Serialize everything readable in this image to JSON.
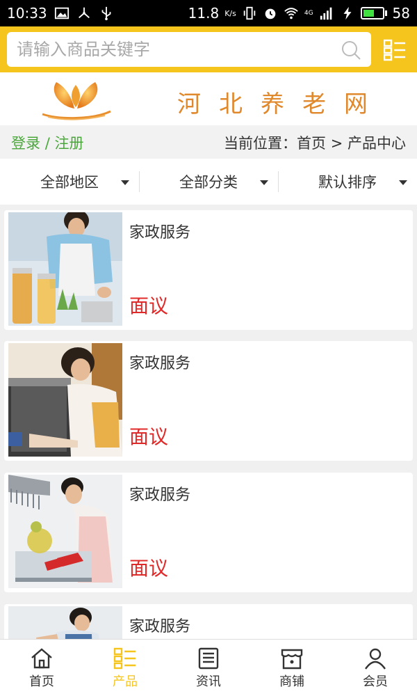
{
  "status_bar": {
    "time": "10:33",
    "speed": "11.8",
    "speed_unit": "K/s",
    "network": "4G",
    "battery": "58",
    "battery_level": 0.58,
    "icons": [
      "image-icon",
      "share-icon",
      "usb-icon",
      "vibrate-icon",
      "alarm-icon",
      "wifi-icon",
      "signal-icon",
      "charging-icon",
      "battery-icon"
    ]
  },
  "search": {
    "placeholder": "请输入商品关键字"
  },
  "brand": {
    "title": "河北养老网"
  },
  "breadcrumb": {
    "login": "登录",
    "separator": "/",
    "register": "注册",
    "location": "当前位置：首页 > 产品中心"
  },
  "filters": [
    {
      "label": "全部地区"
    },
    {
      "label": "全部分类"
    },
    {
      "label": "默认排序"
    }
  ],
  "products": [
    {
      "name": "家政服务",
      "price": "面议"
    },
    {
      "name": "家政服务",
      "price": "面议"
    },
    {
      "name": "家政服务",
      "price": "面议"
    },
    {
      "name": "家政服务",
      "price": ""
    }
  ],
  "nav": {
    "items": [
      {
        "label": "首页",
        "icon": "home-icon",
        "active": false
      },
      {
        "label": "产品",
        "icon": "product-icon",
        "active": true
      },
      {
        "label": "资讯",
        "icon": "news-icon",
        "active": false
      },
      {
        "label": "商铺",
        "icon": "shop-icon",
        "active": false
      },
      {
        "label": "会员",
        "icon": "member-icon",
        "active": false
      }
    ],
    "active_color": "#f5c51d"
  },
  "colors": {
    "accent": "#f5c51d",
    "title": "#e0882c",
    "login": "#4aa83a",
    "price": "#e02a2a"
  }
}
